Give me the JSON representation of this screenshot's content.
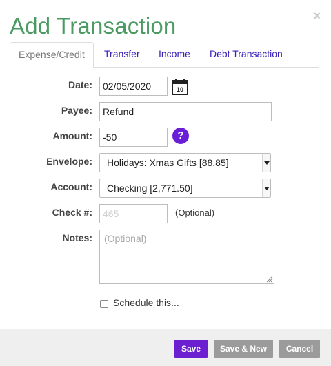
{
  "dialog": {
    "title": "Add Transaction",
    "close_symbol": "×"
  },
  "tabs": [
    {
      "label": "Expense/Credit",
      "active": true
    },
    {
      "label": "Transfer",
      "active": false
    },
    {
      "label": "Income",
      "active": false
    },
    {
      "label": "Debt Transaction",
      "active": false
    }
  ],
  "form": {
    "date": {
      "label": "Date:",
      "value": "02/05/2020",
      "icon": "calendar-icon",
      "icon_day": "10"
    },
    "payee": {
      "label": "Payee:",
      "value": "Refund"
    },
    "amount": {
      "label": "Amount:",
      "value": "-50",
      "help_symbol": "?"
    },
    "envelope": {
      "label": "Envelope:",
      "value": "Holidays: Xmas Gifts [88.85]"
    },
    "account": {
      "label": "Account:",
      "value": "Checking [2,771.50]"
    },
    "check": {
      "label": "Check #:",
      "placeholder": "465",
      "note": "(Optional)"
    },
    "notes": {
      "label": "Notes:",
      "placeholder": "(Optional)"
    },
    "schedule": {
      "label": "Schedule this...",
      "checked": false
    }
  },
  "footer": {
    "save_label": "Save",
    "save_new_label": "Save & New",
    "cancel_label": "Cancel"
  },
  "colors": {
    "title": "#4a9a62",
    "tab_link": "#3a22b8",
    "primary_button": "#6b1fd1",
    "secondary_button": "#9b9b9b",
    "help_icon": "#6a1fd6"
  }
}
